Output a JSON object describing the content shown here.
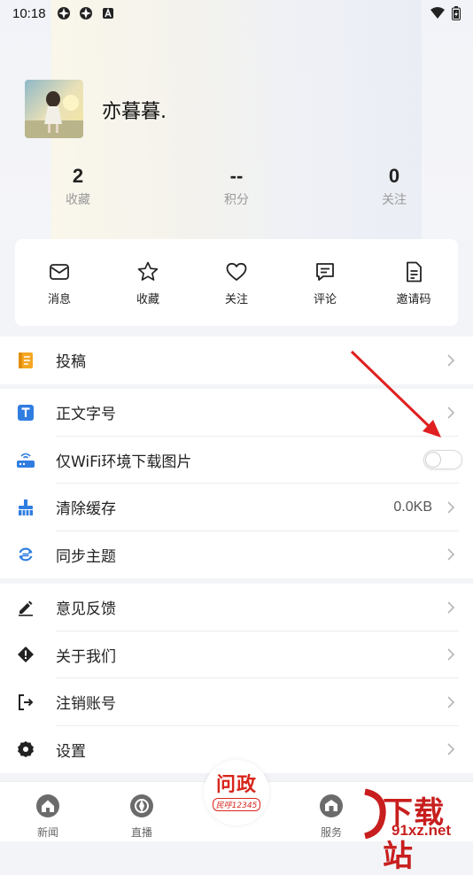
{
  "status_bar": {
    "time": "10:18"
  },
  "profile": {
    "username": "亦暮暮."
  },
  "stats": [
    {
      "value": "2",
      "label": "收藏"
    },
    {
      "value": "--",
      "label": "积分"
    },
    {
      "value": "0",
      "label": "关注"
    }
  ],
  "quick_actions": [
    {
      "label": "消息",
      "icon": "mail-icon"
    },
    {
      "label": "收藏",
      "icon": "star-icon"
    },
    {
      "label": "关注",
      "icon": "heart-icon"
    },
    {
      "label": "评论",
      "icon": "comment-icon"
    },
    {
      "label": "邀请码",
      "icon": "document-icon"
    }
  ],
  "menu": {
    "contribute": {
      "label": "投稿",
      "icon": "notebook-icon",
      "color": "#f5a623"
    },
    "font_size": {
      "label": "正文字号",
      "icon": "text-size-icon",
      "color": "#2f7de1"
    },
    "wifi_images": {
      "label": "仅WiFi环境下载图片",
      "icon": "router-icon",
      "color": "#2f7de1",
      "toggle_on": false
    },
    "clear_cache": {
      "label": "清除缓存",
      "value": "0.0KB",
      "icon": "broom-icon",
      "color": "#2f7de1"
    },
    "sync_theme": {
      "label": "同步主题",
      "icon": "sync-icon",
      "color": "#2f7de1"
    },
    "feedback": {
      "label": "意见反馈",
      "icon": "pencil-icon"
    },
    "about": {
      "label": "关于我们",
      "icon": "diamond-info-icon"
    },
    "logout": {
      "label": "注销账号",
      "icon": "logout-icon"
    },
    "settings": {
      "label": "设置",
      "icon": "gear-icon"
    }
  },
  "tabbar": {
    "news": "新闻",
    "live": "直播",
    "center_title": "问政",
    "center_sub": "民呼12345",
    "service": "服务"
  },
  "watermark": {
    "title": "下载站",
    "url": "91xz.net"
  }
}
